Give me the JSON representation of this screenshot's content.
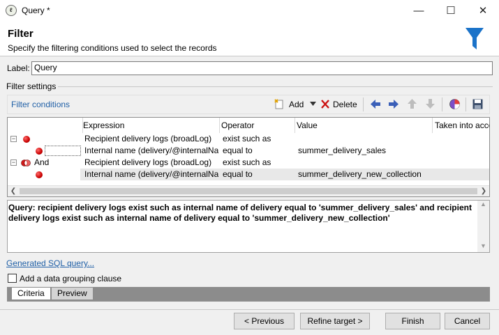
{
  "window": {
    "title": "Query *",
    "icon": "app-icon",
    "min": "—",
    "max": "☐",
    "close": "✕"
  },
  "header": {
    "title": "Filter",
    "subtitle": "Specify the filtering conditions used to select the records",
    "icon": "funnel-icon",
    "accent": "#1b73c9"
  },
  "label": {
    "caption": "Label:",
    "value": "Query"
  },
  "filter_settings": {
    "caption": "Filter settings"
  },
  "toolbar": {
    "conditions_link": "Filter conditions",
    "add_label": "Add",
    "delete_label": "Delete"
  },
  "grid": {
    "columns": [
      "Expression",
      "Operator",
      "Value",
      "Taken into acco"
    ],
    "rows": [
      {
        "bool": "",
        "expression": "Recipient delivery logs (broadLog)",
        "operator": "exist such as",
        "value": ""
      },
      {
        "bool": "",
        "expression": "Internal name (delivery/@internalNa...",
        "operator": "equal to",
        "value": "summer_delivery_sales"
      },
      {
        "bool": "And",
        "expression": "Recipient delivery logs (broadLog)",
        "operator": "exist such as",
        "value": ""
      },
      {
        "bool": "",
        "expression": "Internal name (delivery/@internalNa...",
        "operator": "equal to",
        "value": "summer_delivery_new_collection"
      }
    ]
  },
  "query_text": "Query: recipient delivery logs exist such as internal name of delivery equal to 'summer_delivery_sales' and recipient delivery logs exist such as internal name of delivery equal to 'summer_delivery_new_collection'",
  "links": {
    "sql": "Generated SQL query..."
  },
  "grouping": {
    "label": "Add a data grouping clause",
    "checked": false
  },
  "tabs": [
    "Criteria",
    "Preview"
  ],
  "buttons": {
    "previous": "< Previous",
    "refine": "Refine target >",
    "finish": "Finish",
    "cancel": "Cancel"
  }
}
